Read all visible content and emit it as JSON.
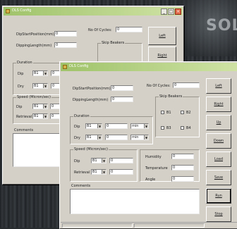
{
  "background": {
    "watermark": "SOL"
  },
  "windows": [
    {
      "title": "DLS Config",
      "labels": {
        "dip_start_position": "DipStartPosition(mm)",
        "dipping_length": "DippingLength(mm)",
        "no_of_cycles": "No Of Cycles:",
        "dip": "Dip",
        "dry": "Dry",
        "retrieval": "Retrieval",
        "comments": "Comments"
      },
      "values": {
        "dip_start_position": "0",
        "dipping_length": "0",
        "no_of_cycles": "0"
      },
      "groups": {
        "skip_beakers": "Skip Beakers",
        "duration": "Duration",
        "speed": "Speed (Micron/sec)"
      },
      "beakers": [
        "B1",
        "B2"
      ],
      "duration": [
        {
          "beaker": "B1",
          "value": "0"
        },
        {
          "beaker": "B1",
          "value": "0"
        }
      ],
      "speed": [
        {
          "beaker": "B1",
          "value": "0"
        },
        {
          "beaker": "B1",
          "value": "0"
        }
      ],
      "buttons": [
        "Left",
        "Right"
      ]
    },
    {
      "title": "DLS Config",
      "labels": {
        "dip_start_position": "DipStartPosition(mm)",
        "dipping_length": "DippingLength(mm)",
        "no_of_cycles": "No Of Cycles:",
        "dip": "Dip",
        "dry": "Dry",
        "retrieval": "Retrieval",
        "humidity": "Humidity",
        "temperature": "Temperature",
        "angle": "Angle",
        "comments": "Comments"
      },
      "values": {
        "dip_start_position": "0",
        "dipping_length": "0",
        "no_of_cycles": "0",
        "humidity": "0",
        "temperature": "0",
        "angle": "0"
      },
      "groups": {
        "skip_beakers": "Skip Beakers",
        "duration": "Duration",
        "speed": "Speed (Micron/sec)"
      },
      "beakers": [
        "B1",
        "B2",
        "B3",
        "B4"
      ],
      "duration": [
        {
          "beaker": "B1",
          "value": "0",
          "unit": "min"
        },
        {
          "beaker": "B1",
          "value": "0",
          "unit": "min"
        }
      ],
      "speed": [
        {
          "beaker": "B1",
          "value": "0"
        },
        {
          "beaker": "B1",
          "value": "0"
        }
      ],
      "buttons": [
        "Left",
        "Right",
        "Up",
        "Down",
        "Load",
        "Save",
        "Run",
        "Stop"
      ]
    }
  ]
}
